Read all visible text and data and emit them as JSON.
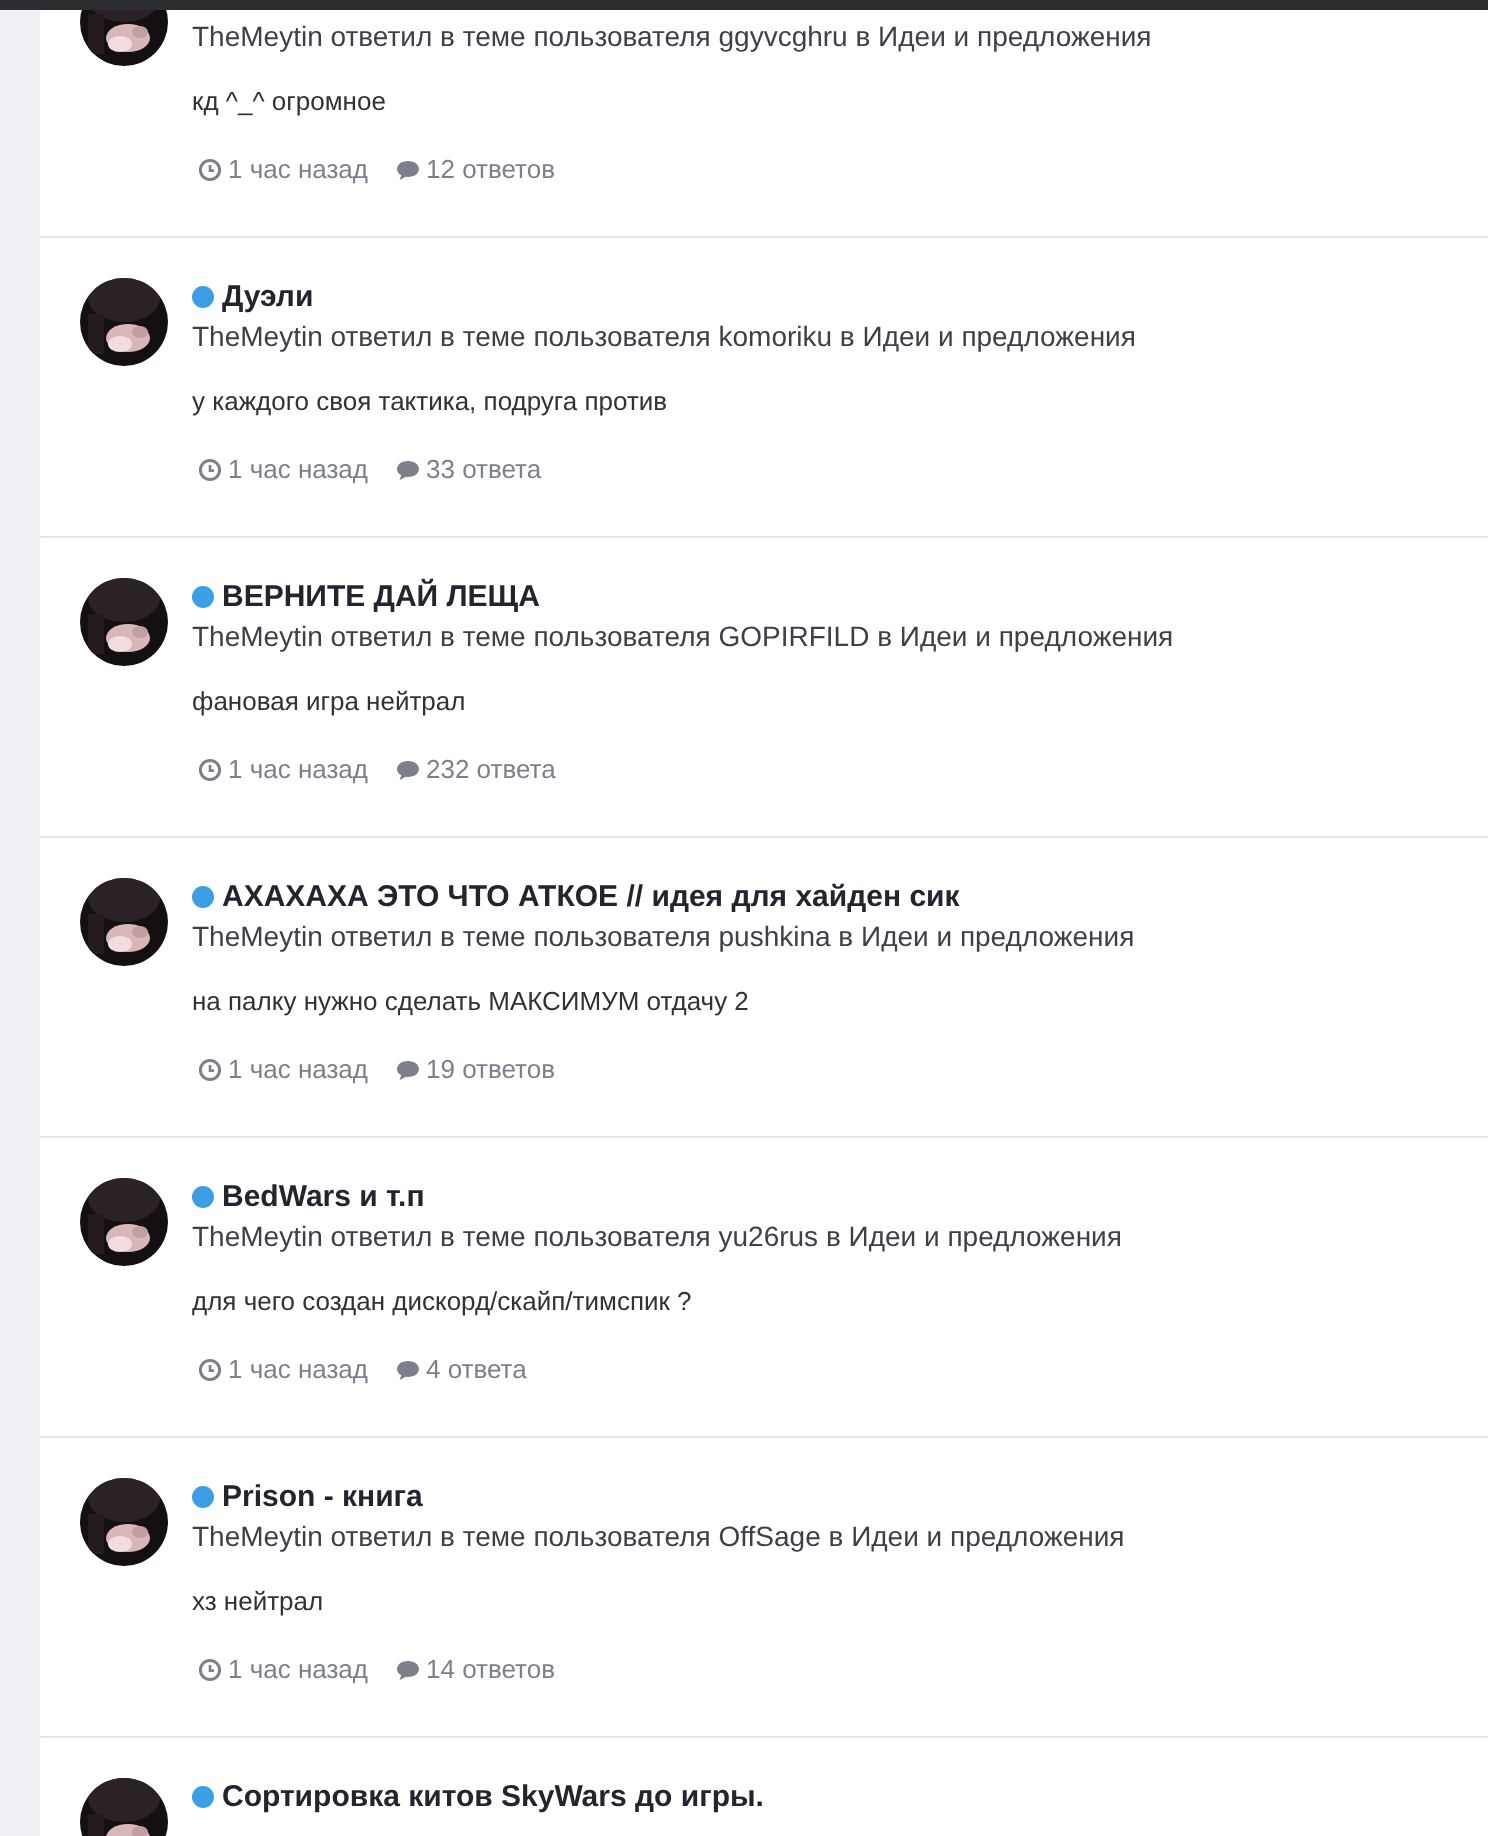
{
  "activity": [
    {
      "byline": "TheMeytin ответил в теме пользователя ggyvcghru в Идеи и предложения",
      "excerpt": "кд ^_^ огромное",
      "time": "1 час назад",
      "replies": "12 ответов"
    },
    {
      "title": "Дуэли",
      "byline": "TheMeytin ответил в теме пользователя komoriku в Идеи и предложения",
      "excerpt": "у каждого своя тактика, подруга против",
      "time": "1 час назад",
      "replies": "33 ответа"
    },
    {
      "title": "ВЕРНИТЕ ДАЙ ЛЕЩА",
      "byline": "TheMeytin ответил в теме пользователя GOPIRFILD в Идеи и предложения",
      "excerpt": "фановая игра нейтрал",
      "time": "1 час назад",
      "replies": "232 ответа"
    },
    {
      "title": "АХАХАХА ЭТО ЧТО АТКОЕ // идея для хайден сик",
      "byline": "TheMeytin ответил в теме пользователя pushkina в Идеи и предложения",
      "excerpt": "на палку нужно сделать МАКСИМУМ отдачу 2",
      "time": "1 час назад",
      "replies": "19 ответов"
    },
    {
      "title": "BedWars и т.п",
      "byline": "TheMeytin ответил в теме пользователя yu26rus в Идеи и предложения",
      "excerpt": "для чего создан дискорд/скайп/тимспик ?",
      "time": "1 час назад",
      "replies": "4 ответа"
    },
    {
      "title": "Prison - книга",
      "byline": "TheMeytin ответил в теме пользователя OffSage в Идеи и предложения",
      "excerpt": "хз нейтрал",
      "time": "1 час назад",
      "replies": "14 ответов"
    },
    {
      "title": "Сортировка китов SkyWars до игры."
    }
  ]
}
